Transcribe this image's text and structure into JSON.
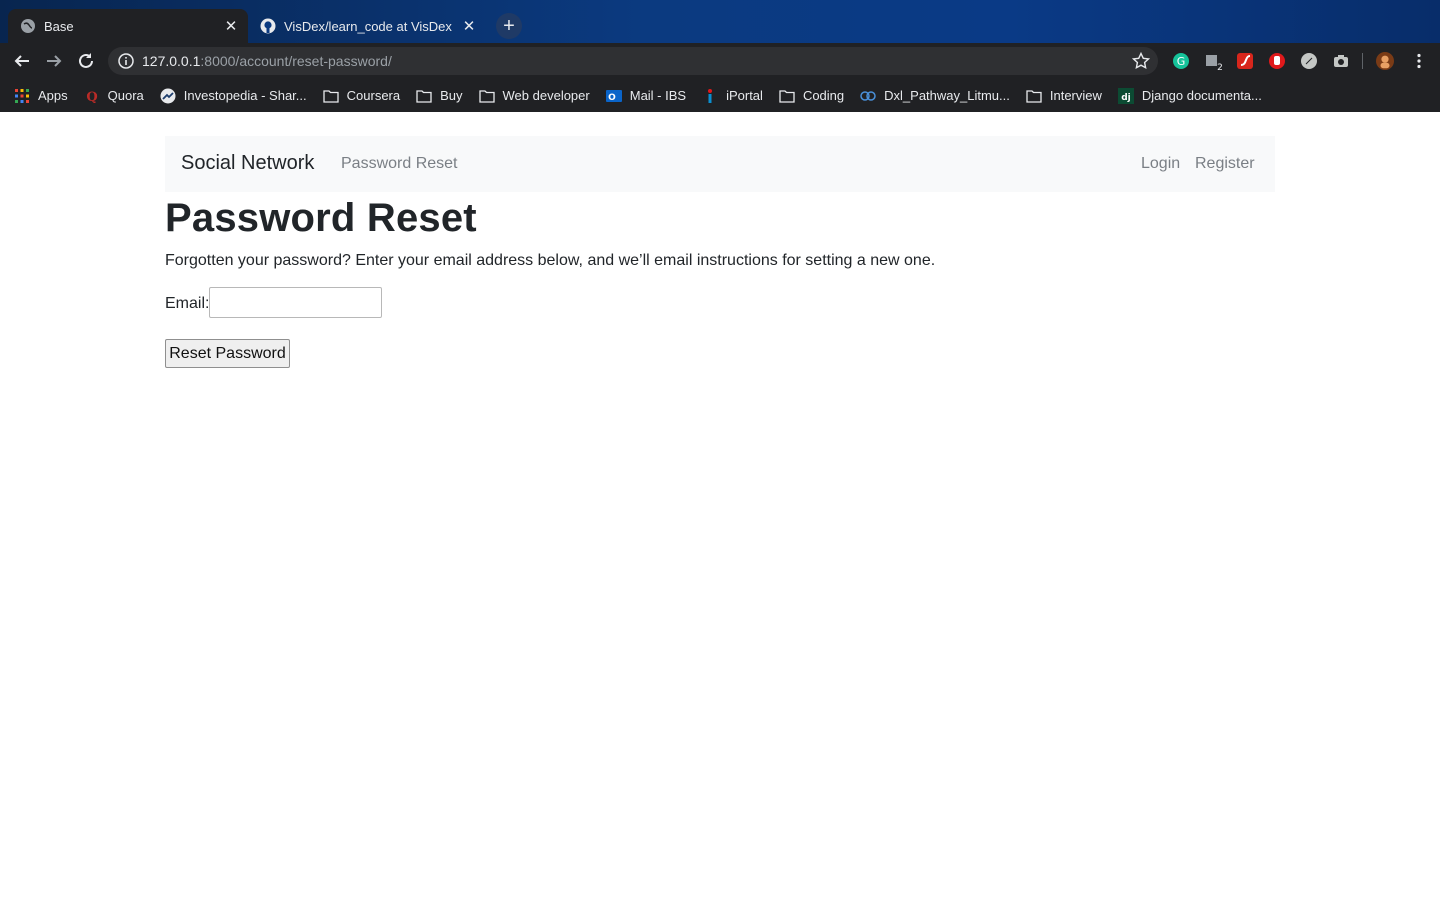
{
  "browser": {
    "tabs": [
      {
        "title": "Base",
        "favicon": "globe-icon",
        "active": true
      },
      {
        "title": "VisDex/learn_code at VisDex",
        "favicon": "github-icon",
        "active": false
      }
    ],
    "url": {
      "host": "127.0.0.1",
      "rest": ":8000/account/reset-password/"
    },
    "bookmarks": [
      {
        "label": "Apps",
        "icon": "apps-grid-icon"
      },
      {
        "label": "Quora",
        "icon": "quora-icon"
      },
      {
        "label": "Investopedia - Shar...",
        "icon": "investopedia-icon"
      },
      {
        "label": "Coursera",
        "icon": "folder-icon"
      },
      {
        "label": "Buy",
        "icon": "folder-icon"
      },
      {
        "label": "Web developer",
        "icon": "folder-icon"
      },
      {
        "label": "Mail - IBS",
        "icon": "outlook-icon"
      },
      {
        "label": "iPortal",
        "icon": "iportal-icon"
      },
      {
        "label": "Coding",
        "icon": "folder-icon"
      },
      {
        "label": "Dxl_Pathway_Litmu...",
        "icon": "litmus-icon"
      },
      {
        "label": "Interview",
        "icon": "folder-icon"
      },
      {
        "label": "Django documenta...",
        "icon": "django-icon"
      }
    ],
    "extension_badge": "2",
    "colors": {
      "tabbar": "#0b3a80",
      "toolbar": "#202124"
    }
  },
  "navbar": {
    "brand": "Social Network",
    "links": {
      "password_reset": "Password Reset",
      "login": "Login",
      "register": "Register"
    }
  },
  "main": {
    "title": "Password Reset",
    "intro": "Forgotten your password? Enter your email address below, and we’ll email instructions for setting a new one.",
    "email_label": "Email:",
    "email_value": "",
    "submit_label": "Reset Password"
  }
}
